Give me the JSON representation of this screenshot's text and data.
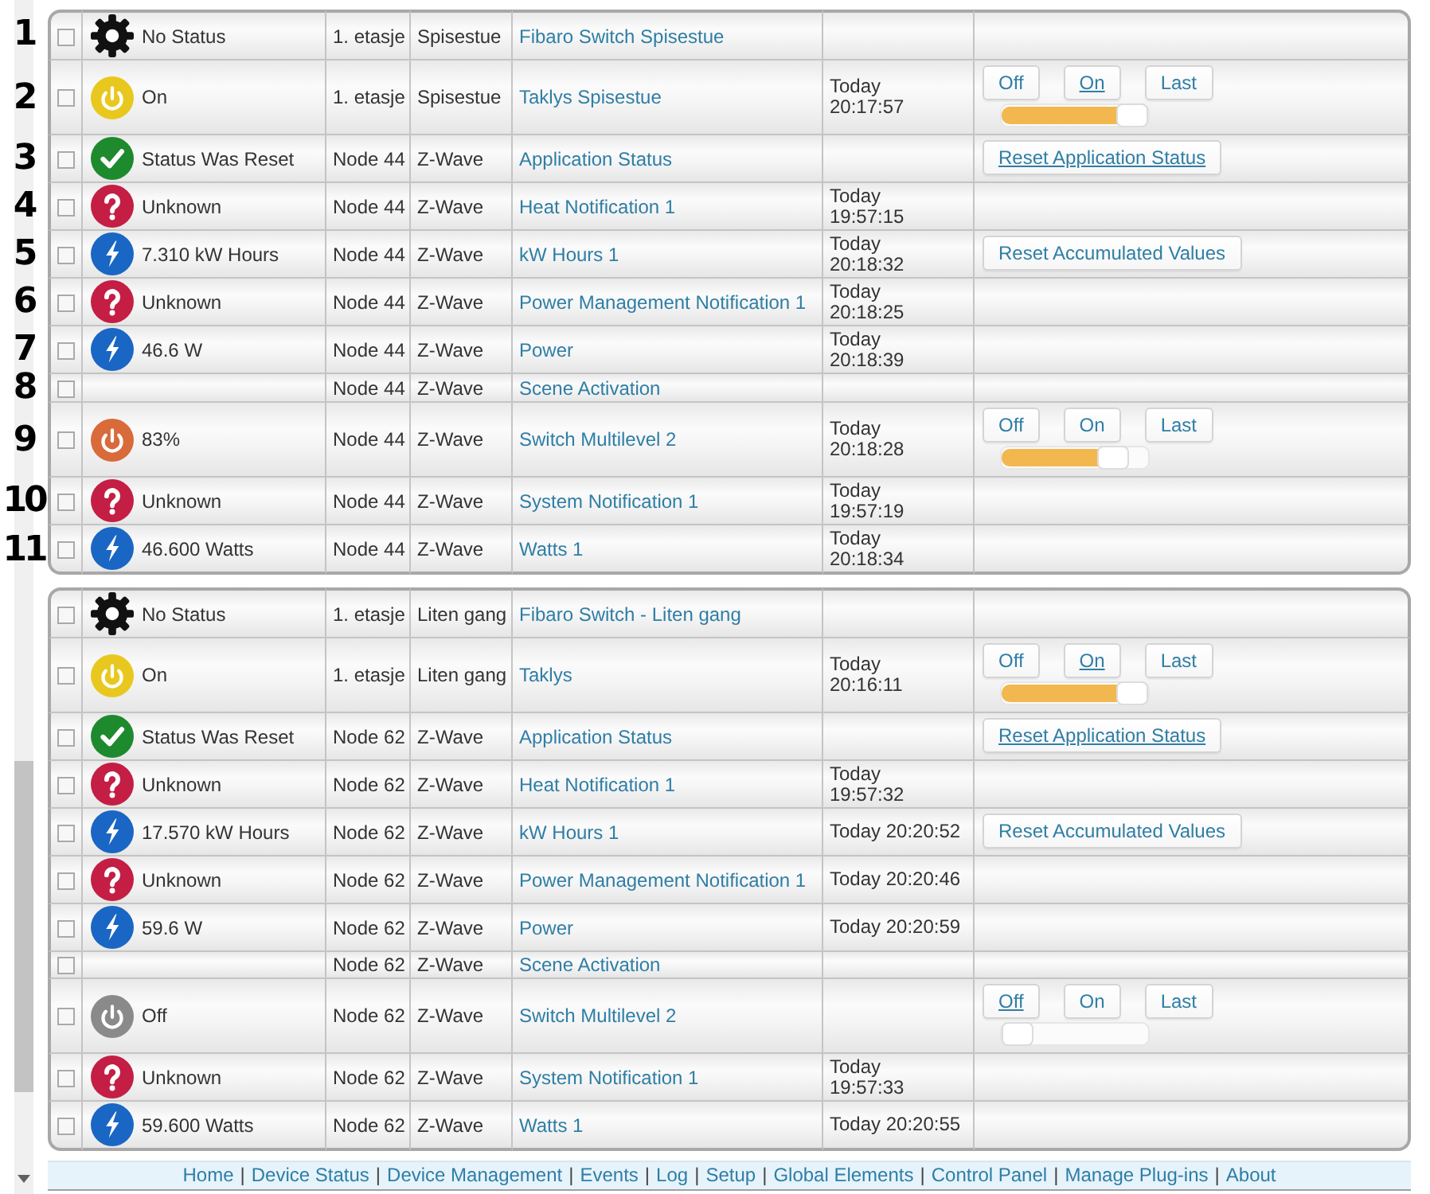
{
  "sections": [
    {
      "rows": [
        {
          "annotation": "1",
          "checked": false,
          "kind": "root",
          "color": "#111111",
          "column_2": "No Status",
          "column_3": "1. etasje",
          "column_4": "Spisestue",
          "column_5": "Fibaro Switch Spisestue"
        },
        {
          "annotation": "2",
          "checked": false,
          "kind": "switch",
          "color": "#e8c81e",
          "column_2": "On",
          "column_3": "1. etasje",
          "column_4": "Spisestue",
          "column_5": "Taklys Spisestue",
          "column_6": "Today\n20:17:57",
          "column_7": [
            {
              "kind": "button",
              "label": "Off",
              "selected": false
            },
            {
              "kind": "button",
              "label": "On",
              "selected": true
            },
            {
              "kind": "button",
              "label": "Last",
              "selected": false
            },
            {
              "kind": "slider",
              "level": 1
            }
          ]
        },
        {
          "annotation": "3",
          "checked": false,
          "kind": "reset",
          "color": "#1e8a2e",
          "column_2": "Status Was Reset",
          "column_3": "Node 44",
          "column_4": "Z-Wave",
          "column_5": "Application Status",
          "column_7": [
            {
              "kind": "button",
              "label": "Reset Application Status",
              "selected": true
            }
          ]
        },
        {
          "annotation": "4",
          "checked": false,
          "kind": "unknown",
          "color": "#c41e45",
          "column_2": "Unknown",
          "column_3": "Node 44",
          "column_4": "Z-Wave",
          "column_5": "Heat Notification 1",
          "column_6": "Today\n19:57:15"
        },
        {
          "annotation": "5",
          "checked": false,
          "kind": "meter",
          "color": "#1a66c4",
          "column_2": "7.310 kW Hours",
          "column_3": "Node 44",
          "column_4": "Z-Wave",
          "column_5": "kW Hours 1",
          "column_6": "Today\n20:18:32",
          "column_7": [
            {
              "kind": "button",
              "label": "Reset Accumulated Values",
              "selected": false
            }
          ]
        },
        {
          "annotation": "6",
          "checked": false,
          "kind": "unknown",
          "color": "#c41e45",
          "column_2": "Unknown",
          "column_3": "Node 44",
          "column_4": "Z-Wave",
          "column_5": "Power Management Notification 1",
          "column_6": "Today\n20:18:25"
        },
        {
          "annotation": "7",
          "checked": false,
          "kind": "meter",
          "color": "#1a66c4",
          "column_2": "46.6 W",
          "column_3": "Node 44",
          "column_4": "Z-Wave",
          "column_5": "Power",
          "column_6": "Today\n20:18:39"
        },
        {
          "annotation": "8",
          "checked": false,
          "kind": "blank",
          "column_3": "Node 44",
          "column_4": "Z-Wave",
          "column_5": "Scene Activation"
        },
        {
          "annotation": "9",
          "checked": false,
          "kind": "switch",
          "color": "#d96a3a",
          "column_2": "83%",
          "column_3": "Node 44",
          "column_4": "Z-Wave",
          "column_5": "Switch Multilevel 2",
          "column_6": "Today\n20:18:28",
          "column_7": [
            {
              "kind": "button",
              "label": "Off",
              "selected": false
            },
            {
              "kind": "button",
              "label": "On",
              "selected": false
            },
            {
              "kind": "button",
              "label": "Last",
              "selected": false
            },
            {
              "kind": "slider",
              "level": 0.83
            }
          ]
        },
        {
          "annotation": "10",
          "checked": false,
          "kind": "unknown",
          "color": "#c41e45",
          "column_2": "Unknown",
          "column_3": "Node 44",
          "column_4": "Z-Wave",
          "column_5": "System Notification 1",
          "column_6": "Today\n19:57:19"
        },
        {
          "annotation": "11",
          "checked": false,
          "kind": "meter",
          "color": "#1a66c4",
          "column_2": "46.600 Watts",
          "column_3": "Node 44",
          "column_4": "Z-Wave",
          "column_5": "Watts 1",
          "column_6": "Today\n20:18:34"
        }
      ]
    },
    {
      "rows": [
        {
          "checked": false,
          "kind": "root",
          "color": "#111111",
          "column_2": "No Status",
          "column_3": "1. etasje",
          "column_4": "Liten gang",
          "column_5": "Fibaro Switch - Liten gang"
        },
        {
          "checked": false,
          "kind": "switch",
          "color": "#e8c81e",
          "column_2": "On",
          "column_3": "1. etasje",
          "column_4": "Liten gang",
          "column_5": "Taklys",
          "column_6": "Today\n20:16:11",
          "column_7": [
            {
              "kind": "button",
              "label": "Off",
              "selected": false
            },
            {
              "kind": "button",
              "label": "On",
              "selected": true
            },
            {
              "kind": "button",
              "label": "Last",
              "selected": false
            },
            {
              "kind": "slider",
              "level": 1
            }
          ]
        },
        {
          "checked": false,
          "kind": "reset",
          "color": "#1e8a2e",
          "column_2": "Status Was Reset",
          "column_3": "Node 62",
          "column_4": "Z-Wave",
          "column_5": "Application Status",
          "column_7": [
            {
              "kind": "button",
              "label": "Reset Application Status",
              "selected": true
            }
          ]
        },
        {
          "checked": false,
          "kind": "unknown",
          "color": "#c41e45",
          "column_2": "Unknown",
          "column_3": "Node 62",
          "column_4": "Z-Wave",
          "column_5": "Heat Notification 1",
          "column_6": "Today\n19:57:32"
        },
        {
          "checked": false,
          "kind": "meter",
          "color": "#1a66c4",
          "column_2": "17.570 kW Hours",
          "column_3": "Node 62",
          "column_4": "Z-Wave",
          "column_5": "kW Hours 1",
          "column_6": "Today 20:20:52",
          "column_7": [
            {
              "kind": "button",
              "label": "Reset Accumulated Values",
              "selected": false
            }
          ]
        },
        {
          "checked": false,
          "kind": "unknown",
          "color": "#c41e45",
          "column_2": "Unknown",
          "column_3": "Node 62",
          "column_4": "Z-Wave",
          "column_5": "Power Management Notification 1",
          "column_6": "Today 20:20:46"
        },
        {
          "checked": false,
          "kind": "meter",
          "color": "#1a66c4",
          "column_2": "59.6 W",
          "column_3": "Node 62",
          "column_4": "Z-Wave",
          "column_5": "Power",
          "column_6": "Today 20:20:59"
        },
        {
          "checked": false,
          "kind": "blank",
          "column_3": "Node 62",
          "column_4": "Z-Wave",
          "column_5": "Scene Activation"
        },
        {
          "checked": false,
          "kind": "switch",
          "color": "#8a8a8a",
          "column_2": "Off",
          "column_3": "Node 62",
          "column_4": "Z-Wave",
          "column_5": "Switch Multilevel 2",
          "column_7": [
            {
              "kind": "button",
              "label": "Off",
              "selected": true
            },
            {
              "kind": "button",
              "label": "On",
              "selected": false
            },
            {
              "kind": "button",
              "label": "Last",
              "selected": false
            },
            {
              "kind": "slider",
              "level": 0
            }
          ]
        },
        {
          "checked": false,
          "kind": "unknown",
          "color": "#c41e45",
          "column_2": "Unknown",
          "column_3": "Node 62",
          "column_4": "Z-Wave",
          "column_5": "System Notification 1",
          "column_6": "Today\n19:57:33"
        },
        {
          "checked": false,
          "kind": "meter",
          "color": "#1a66c4",
          "column_2": "59.600 Watts",
          "column_3": "Node 62",
          "column_4": "Z-Wave",
          "column_5": "Watts 1",
          "column_6": "Today 20:20:55"
        }
      ]
    }
  ],
  "footer": {
    "separator": "|",
    "links": [
      "Home",
      "Device Status",
      "Device Management",
      "Events",
      "Log",
      "Setup",
      "Global Elements",
      "Control Panel",
      "Manage Plug-ins",
      "About"
    ]
  }
}
